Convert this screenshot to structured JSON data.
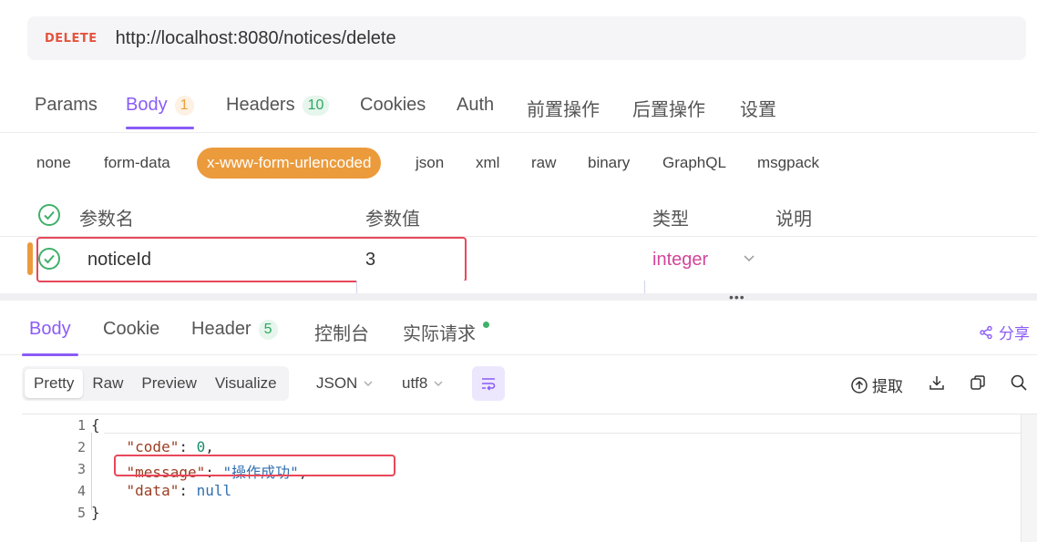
{
  "request": {
    "method": "DELETE",
    "url": "http://localhost:8080/notices/delete"
  },
  "request_tabs": [
    {
      "label": "Params"
    },
    {
      "label": "Body",
      "badge": "1"
    },
    {
      "label": "Headers",
      "badge": "10"
    },
    {
      "label": "Cookies"
    },
    {
      "label": "Auth"
    },
    {
      "label": "前置操作"
    },
    {
      "label": "后置操作"
    },
    {
      "label": "设置"
    }
  ],
  "body_types": [
    "none",
    "form-data",
    "x-www-form-urlencoded",
    "json",
    "xml",
    "raw",
    "binary",
    "GraphQL",
    "msgpack"
  ],
  "params_table": {
    "headers": {
      "name": "参数名",
      "value": "参数值",
      "type": "类型",
      "desc": "说明"
    },
    "row": {
      "name": "noticeId",
      "value": "3",
      "type": "integer"
    }
  },
  "splitter_dots": "•••",
  "response_tabs": [
    {
      "label": "Body"
    },
    {
      "label": "Cookie"
    },
    {
      "label": "Header",
      "badge": "5"
    },
    {
      "label": "控制台"
    },
    {
      "label": "实际请求"
    }
  ],
  "share_label": "分享",
  "view_modes": [
    "Pretty",
    "Raw",
    "Preview",
    "Visualize"
  ],
  "format_select": "JSON",
  "encoding_select": "utf8",
  "extract_label": "提取",
  "line_numbers": [
    "1",
    "2",
    "3",
    "4",
    "5"
  ],
  "response_json": {
    "open": "{",
    "code_key": "\"code\"",
    "code_value": "0",
    "message_key": "\"message\"",
    "message_value": "\"操作成功\"",
    "data_key": "\"data\"",
    "data_value": "null",
    "close": "}"
  },
  "colors": {
    "accent": "#8a5cf6",
    "orange": "#eb9b3c",
    "highlight": "#e8475a",
    "method": "#e5533d",
    "check": "#3fb16a"
  }
}
